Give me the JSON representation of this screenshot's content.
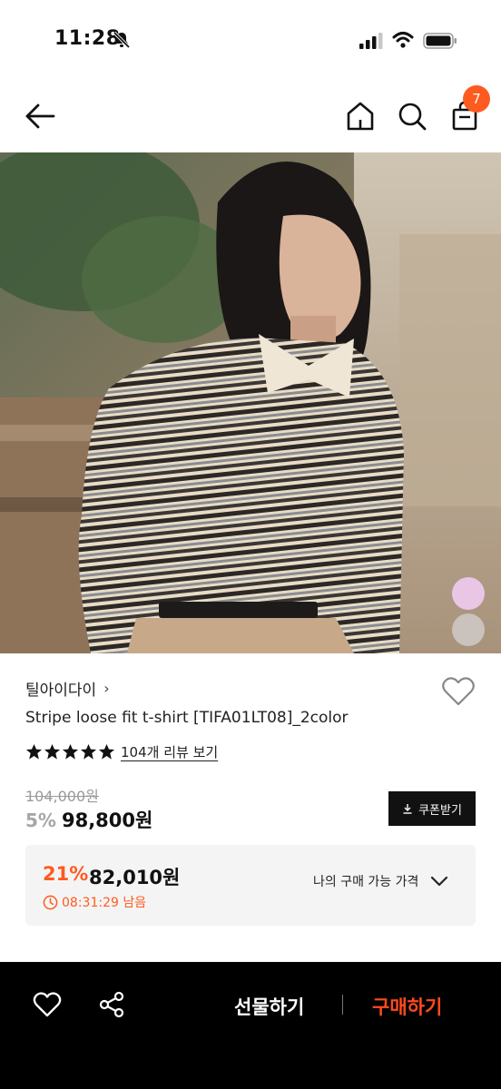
{
  "status_bar": {
    "time": "11:28"
  },
  "nav": {
    "cart_count": "7",
    "icons": [
      "arrow-left-icon",
      "home-icon",
      "search-icon",
      "shopping-bag-icon"
    ]
  },
  "product": {
    "brand": "틸아이다이",
    "brand_chevron": "›",
    "title": "Stripe loose fit t-shirt [TIFA01LT08]_2color",
    "rating_stars": 5,
    "review_link": "104개 리뷰 보기",
    "original_price": "104,000원",
    "discount_rate": "5%",
    "sale_price": "98,800원",
    "coupon_button": "쿠폰받기",
    "color_options": [
      {
        "name": "pink",
        "color": "#e9c6e6"
      },
      {
        "name": "grey",
        "color": "#c9c2bd"
      }
    ]
  },
  "my_price": {
    "rate": "21%",
    "price": "82,010원",
    "timer": "08:31:29 남음",
    "toggle_label": "나의 구매 가능 가격"
  },
  "bottom_bar": {
    "gift_label": "선물하기",
    "buy_label": "구매하기"
  },
  "colors": {
    "accent": "#ff5a1f",
    "bottom_bar_bg": "#000000",
    "coupon_bg": "#111111"
  }
}
